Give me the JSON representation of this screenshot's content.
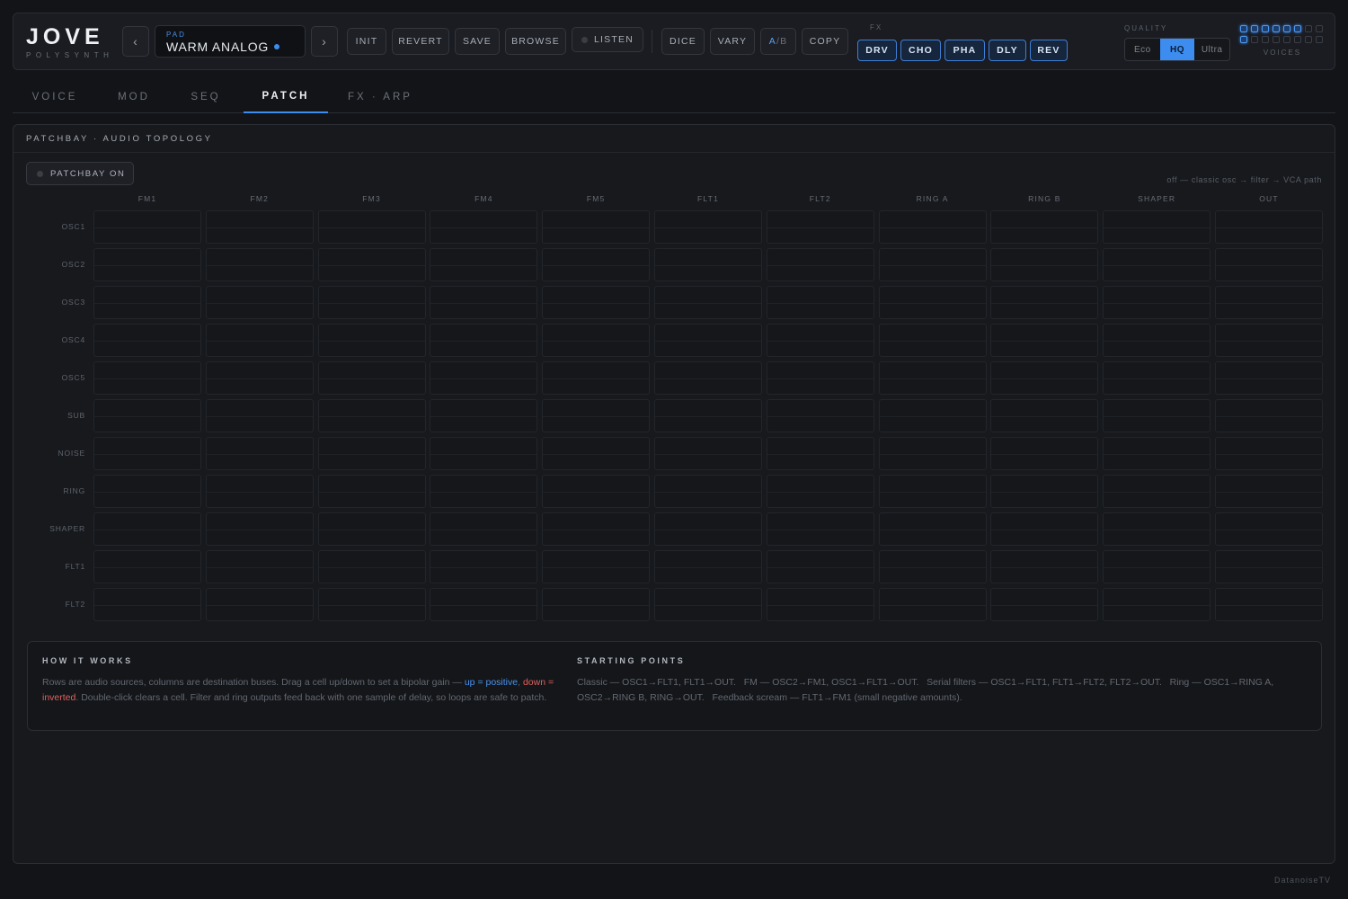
{
  "app": {
    "title": "JOVE",
    "subtitle": "POLYSYNTH"
  },
  "preset": {
    "category": "PAD",
    "name": "WARM ANALOG",
    "prev": "‹",
    "next": "›"
  },
  "toolbar": {
    "init": "INIT",
    "revert": "REVERT",
    "save": "SAVE",
    "browse": "BROWSE",
    "listen": "LISTEN",
    "dice": "DICE",
    "vary": "VARY",
    "ab_a": "A",
    "ab_sep": "/",
    "ab_b": "B",
    "copy": "COPY"
  },
  "fx": {
    "label": "FX",
    "items": [
      "DRV",
      "CHO",
      "PHA",
      "DLY",
      "REV"
    ]
  },
  "quality": {
    "label": "QUALITY",
    "options": [
      "Eco",
      "HQ",
      "Ultra"
    ],
    "selected": "HQ"
  },
  "voices": {
    "label": "VOICES",
    "total": 16,
    "active": 7
  },
  "tabs": [
    "VOICE",
    "MOD",
    "SEQ",
    "PATCH",
    "FX · ARP"
  ],
  "active_tab": "PATCH",
  "patchbay": {
    "title": "PATCHBAY · AUDIO TOPOLOGY",
    "toggle_label": "PATCHBAY ON",
    "legend": "off — classic osc → filter → VCA path",
    "columns": [
      "FM1",
      "FM2",
      "FM3",
      "FM4",
      "FM5",
      "FLT1",
      "FLT2",
      "RING A",
      "RING B",
      "SHAPER",
      "OUT"
    ],
    "rows": [
      "OSC1",
      "OSC2",
      "OSC3",
      "OSC4",
      "OSC5",
      "SUB",
      "NOISE",
      "RING",
      "SHAPER",
      "FLT1",
      "FLT2"
    ]
  },
  "how_it_works": {
    "title": "HOW IT WORKS",
    "text_1": "Rows are audio sources, columns are destination buses. Drag a cell up/down to set a bipolar gain — ",
    "pos": "up = positive",
    "text_2": ", ",
    "neg": "down = inverted",
    "text_3": ". Double-click clears a cell. Filter and ring outputs feed back with one sample of delay, so loops are safe to patch."
  },
  "starting_points": {
    "title": "STARTING POINTS",
    "text": "Classic — OSC1→FLT1, FLT1→OUT.   FM — OSC2→FM1, OSC1→FLT1→OUT.   Serial filters — OSC1→FLT1, FLT1→FLT2, FLT2→OUT.   Ring — OSC1→RING A, OSC2→RING B, RING→OUT.   Feedback scream — FLT1→FM1 (small negative amounts)."
  },
  "footer": "DatanoiseTV"
}
